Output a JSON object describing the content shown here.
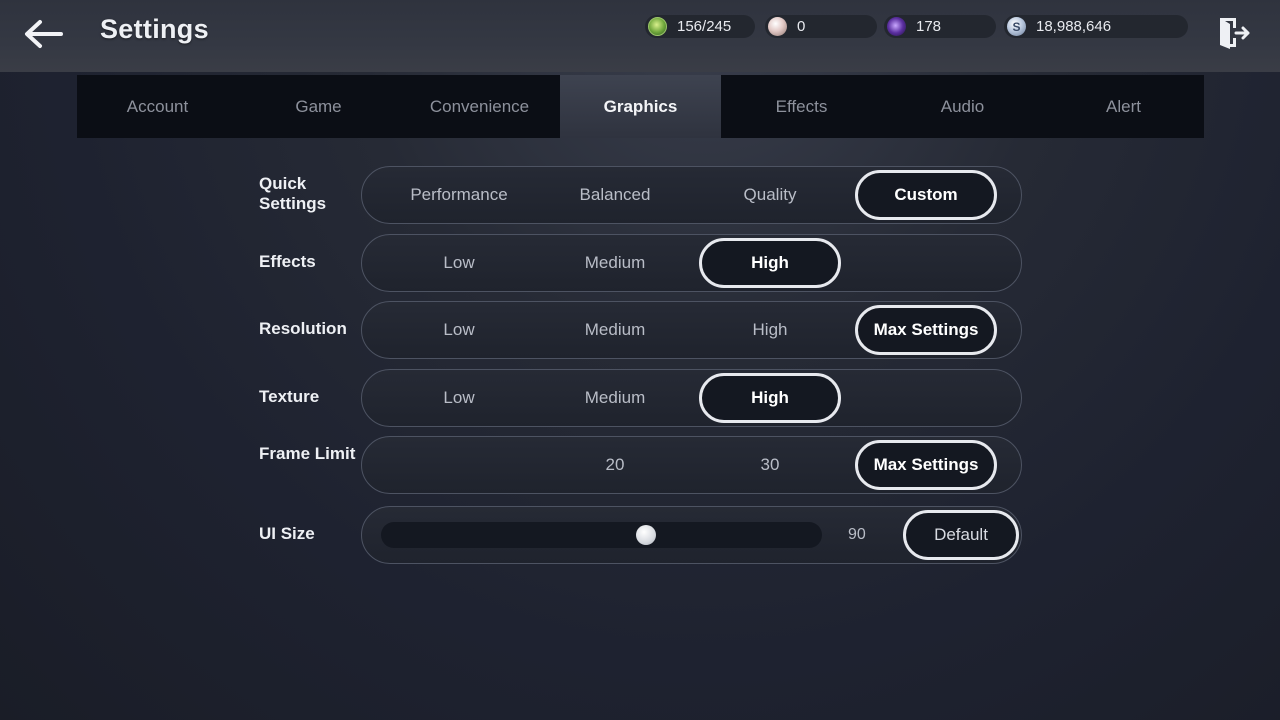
{
  "header": {
    "title": "Settings",
    "back_icon": "arrow-left-icon",
    "exit_icon": "exit-door-icon"
  },
  "currencies": [
    {
      "name": "stamina",
      "value": "156/245",
      "icon": "stamina-icon"
    },
    {
      "name": "pearl",
      "value": "0",
      "icon": "pearl-icon"
    },
    {
      "name": "gem",
      "value": "178",
      "icon": "purple-gem-icon"
    },
    {
      "name": "silver",
      "value": "18,988,646",
      "icon": "silver-coin-icon",
      "glyph": "S"
    }
  ],
  "tabs": [
    {
      "label": "Account",
      "active": false
    },
    {
      "label": "Game",
      "active": false
    },
    {
      "label": "Convenience",
      "active": false
    },
    {
      "label": "Graphics",
      "active": true
    },
    {
      "label": "Effects",
      "active": false
    },
    {
      "label": "Audio",
      "active": false
    },
    {
      "label": "Alert",
      "active": false
    }
  ],
  "settings": {
    "quick_settings": {
      "label": "Quick Settings",
      "options": [
        "Performance",
        "Balanced",
        "Quality",
        "Custom"
      ],
      "selected": "Custom"
    },
    "effects": {
      "label": "Effects",
      "options": [
        "Low",
        "Medium",
        "High"
      ],
      "selected": "High"
    },
    "resolution": {
      "label": "Resolution",
      "options": [
        "Low",
        "Medium",
        "High",
        "Max Settings"
      ],
      "selected": "Max Settings"
    },
    "texture": {
      "label": "Texture",
      "options": [
        "Low",
        "Medium",
        "High"
      ],
      "selected": "High"
    },
    "frame_limit": {
      "label": "Frame Limit",
      "options": [
        "20",
        "30",
        "Max Settings"
      ],
      "selected": "Max Settings"
    },
    "ui_size": {
      "label": "UI Size",
      "value": "90",
      "fraction": 0.6,
      "default_label": "Default"
    }
  },
  "colors": {
    "accent_border": "#e7e9ee",
    "tab_bar": "#0b0e15",
    "active_tab": "#3e4350"
  }
}
